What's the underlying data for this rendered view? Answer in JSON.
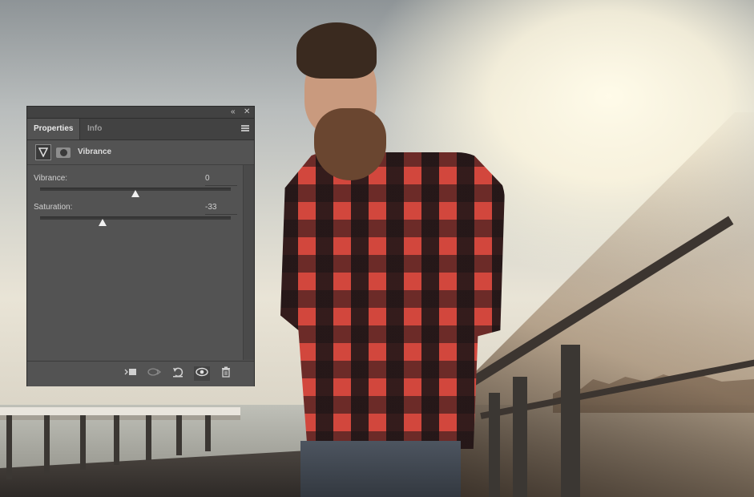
{
  "panel": {
    "tabs": [
      {
        "label": "Properties",
        "active": true
      },
      {
        "label": "Info",
        "active": false
      }
    ],
    "adjustment_title": "Vibrance",
    "sliders": [
      {
        "label": "Vibrance:",
        "value": "0",
        "position": 0.5
      },
      {
        "label": "Saturation:",
        "value": "-33",
        "position": 0.33
      }
    ],
    "footer_icons": [
      "clip-to-layer-icon",
      "view-previous-state-icon",
      "reset-icon",
      "visibility-eye-icon",
      "trash-icon"
    ]
  }
}
